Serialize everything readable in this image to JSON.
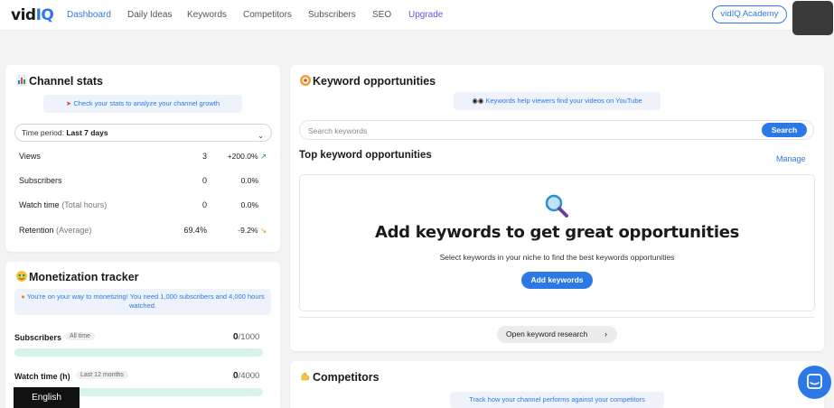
{
  "nav": {
    "logo_prefix": "vid",
    "logo_suffix": "IQ",
    "items": [
      {
        "label": "Dashboard",
        "active": true
      },
      {
        "label": "Daily Ideas"
      },
      {
        "label": "Keywords"
      },
      {
        "label": "Competitors"
      },
      {
        "label": "Subscribers"
      },
      {
        "label": "SEO"
      },
      {
        "label": "Upgrade"
      }
    ],
    "academy_label": "vidIQ Academy"
  },
  "channel_stats": {
    "title": "Channel stats",
    "hint": "Check your stats to analyze your channel growth",
    "period_label": "Time period:",
    "period_value": "Last 7 days",
    "rows": [
      {
        "label": "Views",
        "muted": "",
        "value": "3",
        "change": "+200.0%",
        "trend": "up"
      },
      {
        "label": "Subscribers",
        "muted": "",
        "value": "0",
        "change": "0.0%",
        "trend": "none"
      },
      {
        "label": "Watch time",
        "muted": "(Total hours)",
        "value": "0",
        "change": "0.0%",
        "trend": "none"
      },
      {
        "label": "Retention",
        "muted": "(Average)",
        "value": "69.4%",
        "change": "-9.2%",
        "trend": "down"
      }
    ]
  },
  "monetization": {
    "title": "Monetization tracker",
    "note": "You're on your way to monetizing! You need 1,000 subscribers and 4,000 hours watched.",
    "subscribers": {
      "label": "Subscribers",
      "tag": "All time",
      "current": "0",
      "target": "/1000",
      "progress": 0
    },
    "watch_time": {
      "label": "Watch time (h)",
      "tag": "Last 12 months",
      "current": "0",
      "target": "/4000",
      "progress": 0
    }
  },
  "keyword_opps": {
    "title": "Keyword opportunities",
    "hint": "Keywords help viewers find your videos on YouTube",
    "search_placeholder": "Search keywords",
    "search_button": "Search",
    "top_title": "Top keyword opportunities",
    "manage": "Manage",
    "empty_heading": "Add keywords to get great opportunities",
    "empty_sub": "Select keywords in your niche to find the best keywords opportunities",
    "add_button": "Add keywords",
    "open_research": "Open keyword research"
  },
  "competitors": {
    "title": "Competitors",
    "hint": "Track how your channel performs against your competitors"
  },
  "language_label": "English",
  "colors": {
    "accent": "#2c79e6",
    "upgrade": "#6b4de6",
    "positive": "#18a058",
    "negative": "#e88a1a",
    "progress_track": "#d6f5e8"
  }
}
